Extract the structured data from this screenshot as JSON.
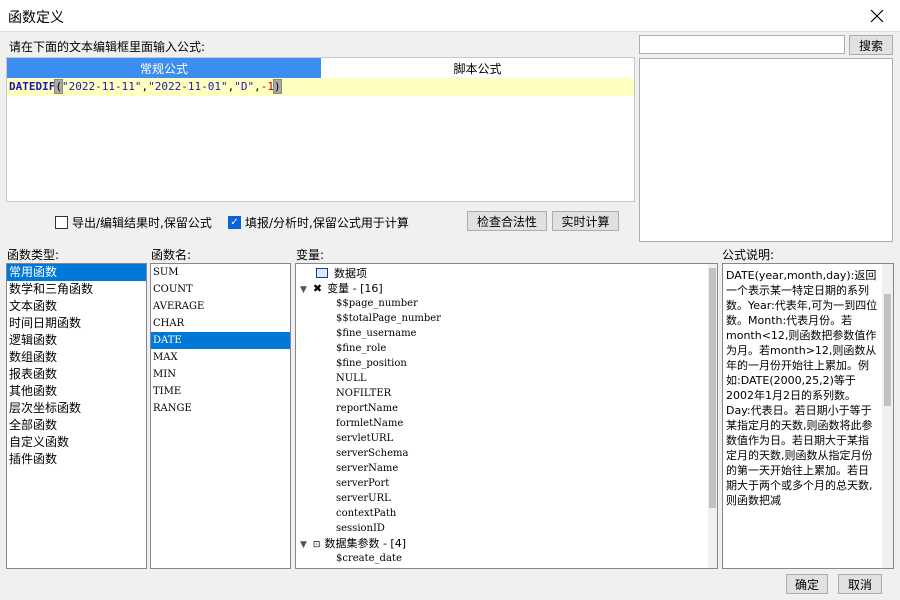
{
  "window": {
    "title": "函数定义"
  },
  "editor": {
    "prompt": "请在下面的文本编辑框里面输入公式:",
    "tabs": [
      "常规公式",
      "脚本公式"
    ],
    "code": {
      "fn": "DATEDIF",
      "open": "(",
      "arg1": "\"2022-11-11\"",
      "sep1": ",",
      "arg2": "\"2022-11-01\"",
      "sep2": ",",
      "arg3": "\"D\"",
      "sep3": ",",
      "arg4": "-1",
      "close": ")"
    }
  },
  "search": {
    "button": "搜索",
    "value": ""
  },
  "options": {
    "keep_formula_export": {
      "label": "导出/编辑结果时,保留公式",
      "checked": false
    },
    "keep_formula_fill": {
      "label": "填报/分析时,保留公式用于计算",
      "checked": true
    },
    "validate_button": "检查合法性",
    "realtime_button": "实时计算"
  },
  "labels": {
    "types": "函数类型:",
    "names": "函数名:",
    "vars": "变量:",
    "desc": "公式说明:"
  },
  "function_types": [
    "常用函数",
    "数学和三角函数",
    "文本函数",
    "时间日期函数",
    "逻辑函数",
    "数组函数",
    "报表函数",
    "其他函数",
    "层次坐标函数",
    "全部函数",
    "自定义函数",
    "插件函数"
  ],
  "function_types_selected": 0,
  "function_names": [
    "SUM",
    "COUNT",
    "AVERAGE",
    "CHAR",
    "DATE",
    "MAX",
    "MIN",
    "TIME",
    "RANGE"
  ],
  "function_names_selected": 4,
  "variables": {
    "data_item": "数据项",
    "var_group": "变量 - [16]",
    "vars": [
      "$$page_number",
      "$$totalPage_number",
      "$fine_username",
      "$fine_role",
      "$fine_position",
      "NULL",
      "NOFILTER",
      "reportName",
      "formletName",
      "servletURL",
      "serverSchema",
      "serverName",
      "serverPort",
      "serverURL",
      "contextPath",
      "sessionID"
    ],
    "dataset_group": "数据集参数 - [4]",
    "dataset_vars": [
      "$create_date"
    ]
  },
  "description": "DATE(year,month,day):返回一个表示某一特定日期的系列数。Year:代表年,可为一到四位数。Month:代表月份。若month<12,则函数把参数值作为月。若month>12,则函数从年的一月份开始往上累加。例如:DATE(2000,25,2)等于2002年1月2日的系列数。Day:代表日。若日期小于等于某指定月的天数,则函数将此参数值作为日。若日期大于某指定月的天数,则函数从指定月份的第一天开始往上累加。若日期大于两个或多个月的总天数,则函数把减",
  "footer": {
    "ok": "确定",
    "cancel": "取消"
  },
  "colors": {
    "accent": "#3c8df0",
    "selection": "#0078d7",
    "highlight_line": "#ffffbf"
  }
}
